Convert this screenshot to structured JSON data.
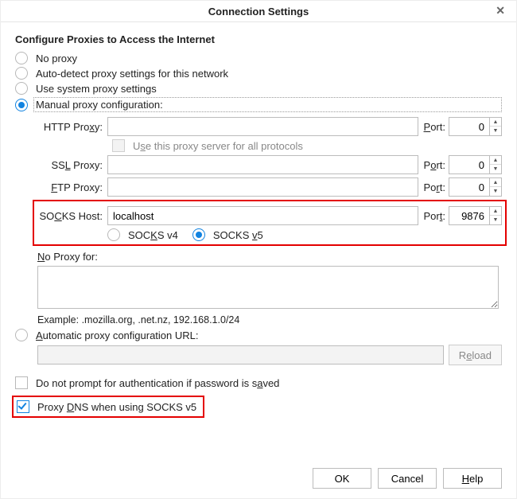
{
  "title": "Connection Settings",
  "heading": "Configure Proxies to Access the Internet",
  "proxy_modes": {
    "no_proxy": "No proxy",
    "auto_detect": "Auto-detect proxy settings for this network",
    "system": "Use system proxy settings",
    "manual": "Manual proxy configuration:"
  },
  "labels": {
    "http": "HTTP Proxy:",
    "ssl": "SSL Proxy:",
    "ftp": "FTP Proxy:",
    "socks": "SOCKS Host:",
    "port": "Port:",
    "use_for_all": "Use this proxy server for all protocols",
    "socks_v4": "SOCKS v4",
    "socks_v5": "SOCKS v5",
    "no_proxy_for": "No Proxy for:",
    "example": "Example: .mozilla.org, .net.nz, 192.168.1.0/24",
    "auto_url": "Automatic proxy configuration URL:",
    "reload": "Reload",
    "no_prompt_auth": "Do not prompt for authentication if password is saved",
    "proxy_dns_socks5": "Proxy DNS when using SOCKS v5"
  },
  "values": {
    "http": "",
    "http_port": "0",
    "ssl": "",
    "ssl_port": "0",
    "ftp": "",
    "ftp_port": "0",
    "socks": "localhost",
    "socks_port": "9876",
    "auto_url": ""
  },
  "buttons": {
    "ok": "OK",
    "cancel": "Cancel",
    "help": "Help"
  }
}
